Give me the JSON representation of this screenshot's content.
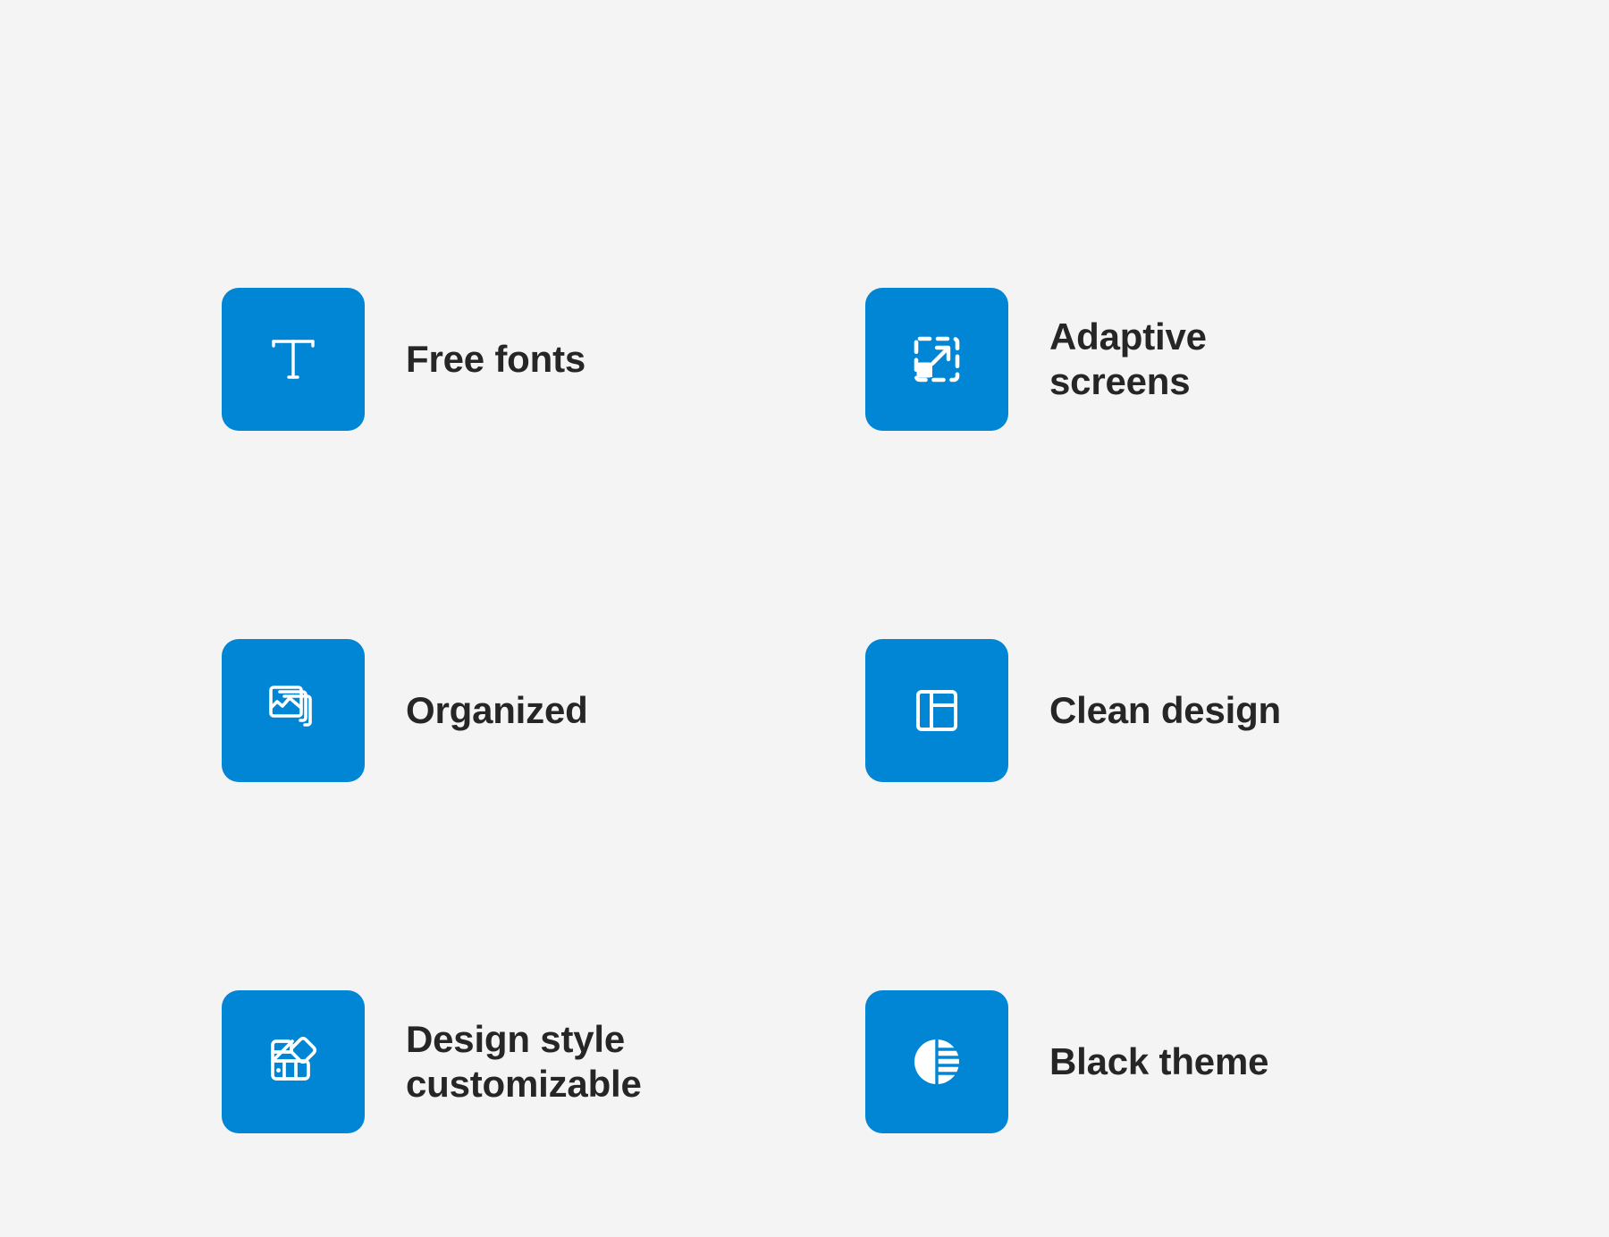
{
  "page": {
    "background_color": "#f4f4f4",
    "accent_color": "#0086d4",
    "text_color": "#262626"
  },
  "features": [
    {
      "id": "free-fonts",
      "label": "Free fonts",
      "icon": "text-format-icon",
      "row": 1,
      "col": 1
    },
    {
      "id": "adaptive-screens",
      "label": "Adaptive\nscreens",
      "icon": "resize-expand-icon",
      "row": 1,
      "col": 2
    },
    {
      "id": "organized",
      "label": "Organized",
      "icon": "photo-stack-icon",
      "row": 2,
      "col": 1
    },
    {
      "id": "clean-design",
      "label": "Clean design",
      "icon": "layout-dashboard-icon",
      "row": 2,
      "col": 2
    },
    {
      "id": "design-style-customizable",
      "label": "Design style\ncustomizable",
      "icon": "style-swatches-icon",
      "row": 3,
      "col": 1
    },
    {
      "id": "black-theme",
      "label": "Black theme",
      "icon": "contrast-circle-icon",
      "row": 3,
      "col": 2
    }
  ]
}
